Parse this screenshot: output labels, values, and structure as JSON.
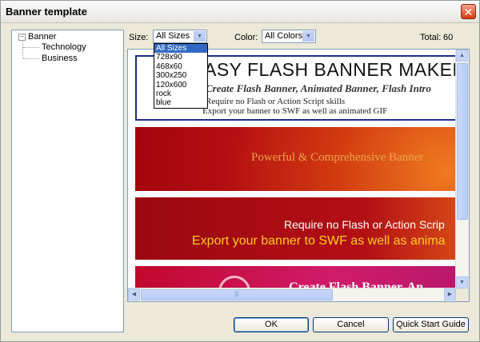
{
  "window": {
    "title": "Banner template",
    "close_symbol": "✕"
  },
  "tree": {
    "root": {
      "label": "Banner",
      "expander_symbol": "−"
    },
    "children": [
      {
        "label": "Technology"
      },
      {
        "label": "Business"
      }
    ]
  },
  "filters": {
    "size_label": "Size:",
    "size_value": "All Sizes",
    "size_options": [
      "All Sizes",
      "728x90",
      "468x60",
      "300x250",
      "120x600",
      "rock",
      "blue"
    ],
    "color_label": "Color:",
    "color_value": "All Colors",
    "total_label": "Total:",
    "total_value": "60"
  },
  "banners": [
    {
      "title": "ASY FLASH BANNER MAKER",
      "subtitle": "Create Flash Banner, Animated Banner, Flash Intro",
      "line1": "Require no Flash or Action Script skills",
      "line2": "Export your banner to SWF as well as animated GIF"
    },
    {
      "text": "Powerful & Comprehensive Banner"
    },
    {
      "line1": "Require no Flash or Action Scrip",
      "line2": "Export your banner to SWF as well as anima"
    },
    {
      "text": "Create Flash Banner, An"
    }
  ],
  "buttons": {
    "ok": "OK",
    "cancel": "Cancel",
    "quick_start": "Quick Start Guide"
  },
  "icons": {
    "scroll_up": "▲",
    "scroll_down": "▼",
    "scroll_left": "◀",
    "scroll_right": "▶",
    "dropdown_arrow": "▼",
    "grip": "|||"
  },
  "colors": {
    "selection": "#316ac5",
    "banner_border": "#1c2e8a"
  }
}
